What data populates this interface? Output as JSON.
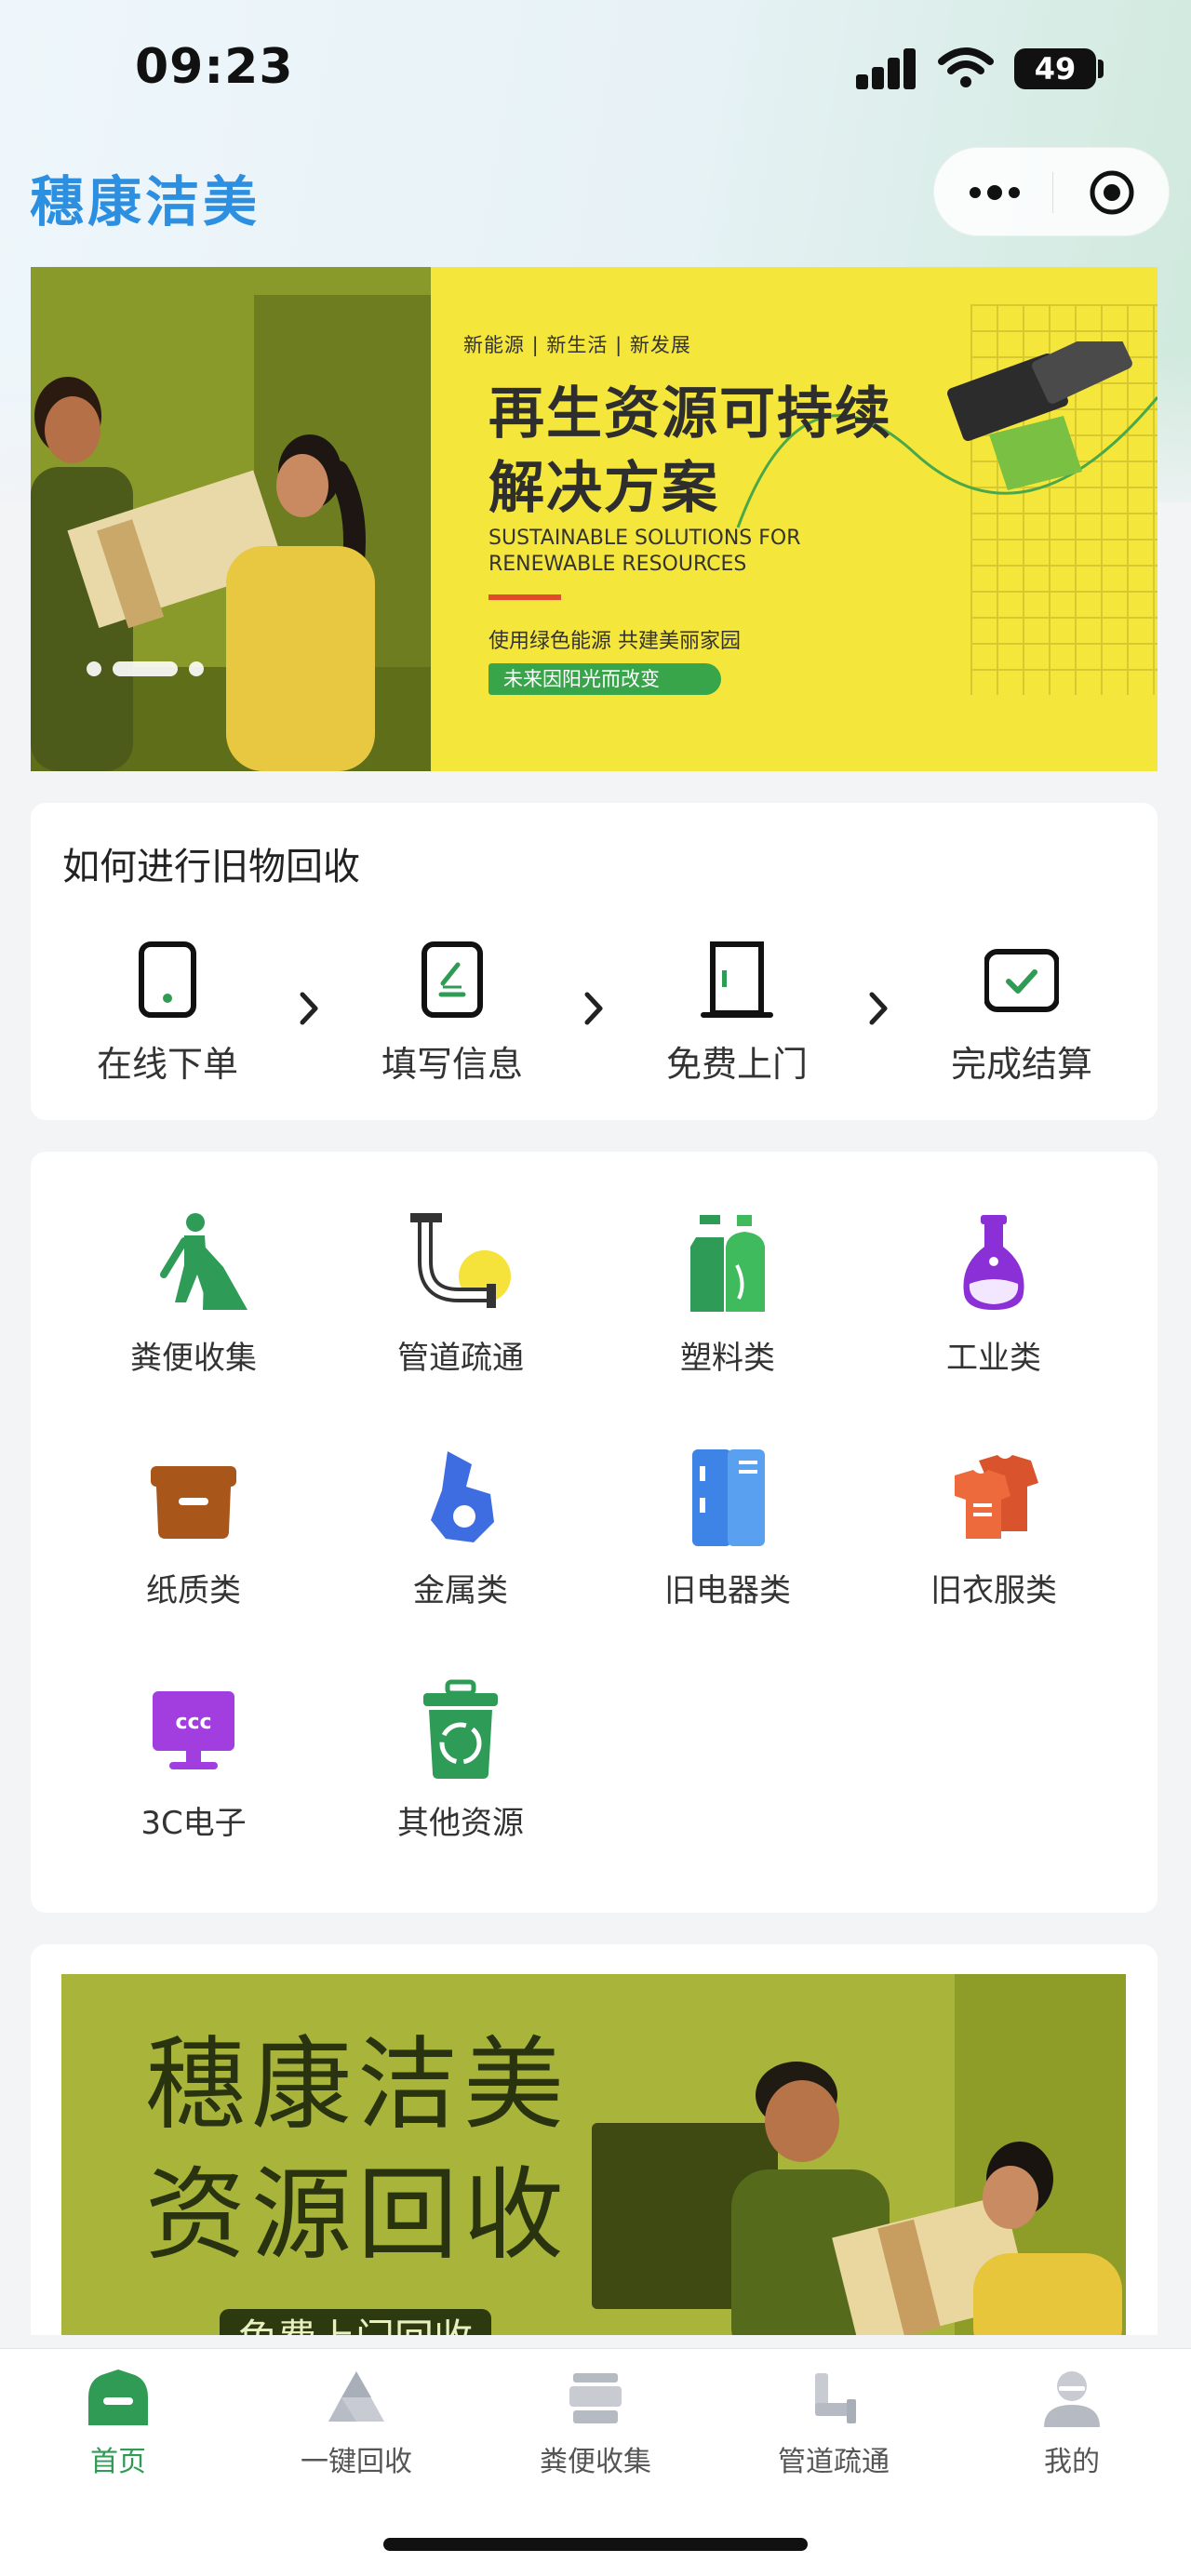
{
  "status_bar": {
    "time": "09:23",
    "battery": "49"
  },
  "header": {
    "brand": "穗康洁美"
  },
  "banner": {
    "tags": "新能源 | 新生活 | 新发展",
    "title_line1": "再生资源可持续",
    "title_line2": "解决方案",
    "en_line1": "SUSTAINABLE SOLUTIONS FOR",
    "en_line2": "RENEWABLE RESOURCES",
    "sub": "使用绿色能源 共建美丽家园",
    "pill": "未来因阳光而改变"
  },
  "steps": {
    "title": "如何进行旧物回收",
    "items": [
      {
        "label": "在线下单",
        "icon": "phone-icon"
      },
      {
        "label": "填写信息",
        "icon": "form-icon"
      },
      {
        "label": "免费上门",
        "icon": "door-icon"
      },
      {
        "label": "完成结算",
        "icon": "check-icon"
      }
    ]
  },
  "categories": [
    {
      "label": "粪便收集",
      "icon": "worker-shovel-icon"
    },
    {
      "label": "管道疏通",
      "icon": "pipe-icon"
    },
    {
      "label": "塑料类",
      "icon": "plastic-bottle-icon"
    },
    {
      "label": "工业类",
      "icon": "flask-icon"
    },
    {
      "label": "纸质类",
      "icon": "paper-box-icon"
    },
    {
      "label": "金属类",
      "icon": "metal-icon"
    },
    {
      "label": "旧电器类",
      "icon": "fridge-icon"
    },
    {
      "label": "旧衣服类",
      "icon": "clothes-icon"
    },
    {
      "label": "3C电子",
      "icon": "monitor-icon"
    },
    {
      "label": "其他资源",
      "icon": "recycle-bin-icon"
    }
  ],
  "promo": {
    "title_line1": "穗康洁美",
    "title_line2": "资源回收",
    "pill": "免费上门回收"
  },
  "tabbar": {
    "items": [
      {
        "label": "首页",
        "icon": "home-icon"
      },
      {
        "label": "一键回收",
        "icon": "recycle-triangle-icon"
      },
      {
        "label": "粪便收集",
        "icon": "truck-icon"
      },
      {
        "label": "管道疏通",
        "icon": "pipe-tab-icon"
      },
      {
        "label": "我的",
        "icon": "user-icon"
      }
    ]
  },
  "colors": {
    "brand": "#2d8fe0",
    "active_tab": "#2f9b55",
    "banner_yellow": "#f5e63c",
    "promo_green": "#a8b53a"
  }
}
